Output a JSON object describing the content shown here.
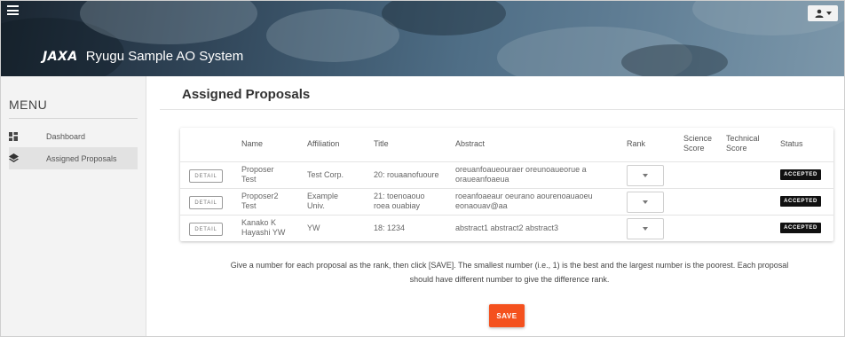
{
  "header": {
    "logo_text": "JAXA",
    "app_title": "Ryugu Sample AO System"
  },
  "sidebar": {
    "menu_title": "MENU",
    "items": [
      {
        "label": "Dashboard",
        "icon": "dashboard-icon"
      },
      {
        "label": "Assigned Proposals",
        "icon": "layers-icon",
        "active": true
      }
    ]
  },
  "main": {
    "page_title": "Assigned Proposals",
    "table": {
      "headers": {
        "name": "Name",
        "affiliation": "Affiliation",
        "title": "Title",
        "abstract": "Abstract",
        "rank": "Rank",
        "science_score_1": "Science",
        "science_score_2": "Score",
        "technical_score_1": "Technical",
        "technical_score_2": "Score",
        "status": "Status"
      },
      "detail_label": "DETAIL",
      "rows": [
        {
          "name_1": "Proposer",
          "name_2": "Test",
          "affiliation_1": "Test Corp.",
          "affiliation_2": "",
          "title_1": "20: rouaanofuoure",
          "title_2": "",
          "abstract_1": "oreuanfoaueouraer oreunoaueorue a",
          "abstract_2": "oraueanfoaeua",
          "status": "ACCEPTED"
        },
        {
          "name_1": "Proposer2",
          "name_2": "Test",
          "affiliation_1": "Example",
          "affiliation_2": "Univ.",
          "title_1": "21: toenoaouo",
          "title_2": "roea ouabiay",
          "abstract_1": "roeanfoaeaur oeurano aourenoauaoeu",
          "abstract_2": "eonaouav@aa",
          "status": "ACCEPTED"
        },
        {
          "name_1": "Kanako K",
          "name_2": "Hayashi YW",
          "affiliation_1": "YW",
          "affiliation_2": "",
          "title_1": "18: 1234",
          "title_2": "",
          "abstract_1": "abstract1 abstract2 abstract3",
          "abstract_2": "",
          "status": "ACCEPTED"
        }
      ]
    },
    "instructions_1": "Give a number for each proposal as the rank, then click [SAVE]. The smallest number (i.e., 1) is the best and the largest number is the poorest. Each proposal",
    "instructions_2": "should have different number to give the difference rank.",
    "save_label": "SAVE"
  },
  "colors": {
    "accent": "#f4511e",
    "badge": "#111111",
    "sidebar_bg": "#f3f3f3"
  }
}
